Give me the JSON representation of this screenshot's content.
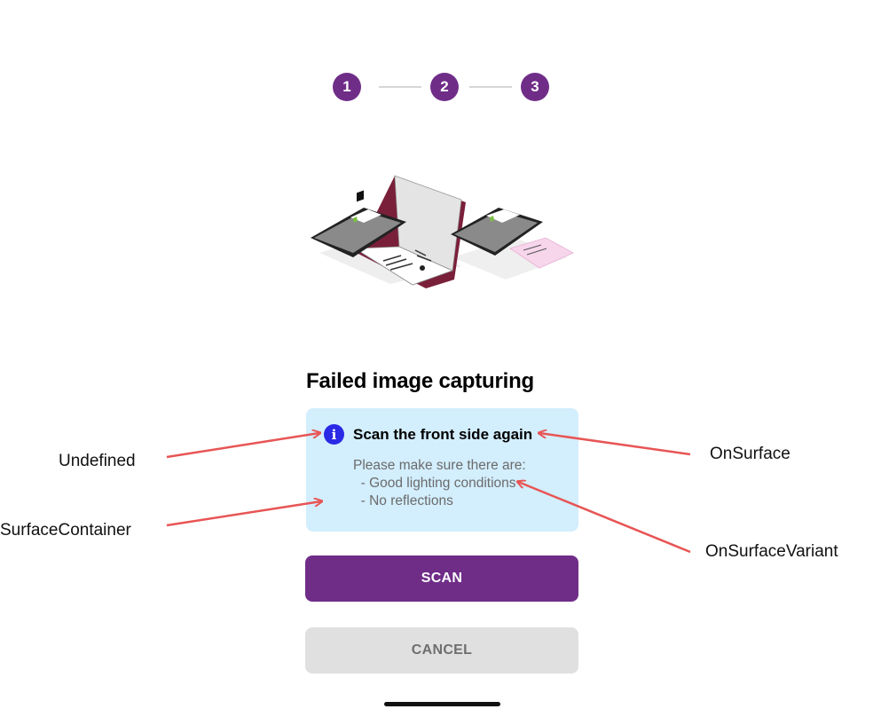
{
  "stepper": {
    "steps": [
      "1",
      "2",
      "3"
    ]
  },
  "title": "Failed image capturing",
  "info": {
    "icon": "info-icon",
    "heading": "Scan the front side again",
    "body": "Please make sure there are:\n  - Good lighting conditions\n  - No reflections"
  },
  "buttons": {
    "scan": "SCAN",
    "cancel": "CANCEL"
  },
  "annotations": {
    "undefined": "Undefined",
    "surface_container": "SurfaceContainer",
    "on_surface": "OnSurface",
    "on_surface_variant": "OnSurfaceVariant"
  },
  "colors": {
    "primary": "#6f2d88",
    "surface_container": "#d3eefd",
    "info_icon": "#2a2ae6",
    "on_surface_variant": "#6b6b6b",
    "cancel_bg": "#e0e0e0",
    "annotation_arrow": "#e85555"
  }
}
